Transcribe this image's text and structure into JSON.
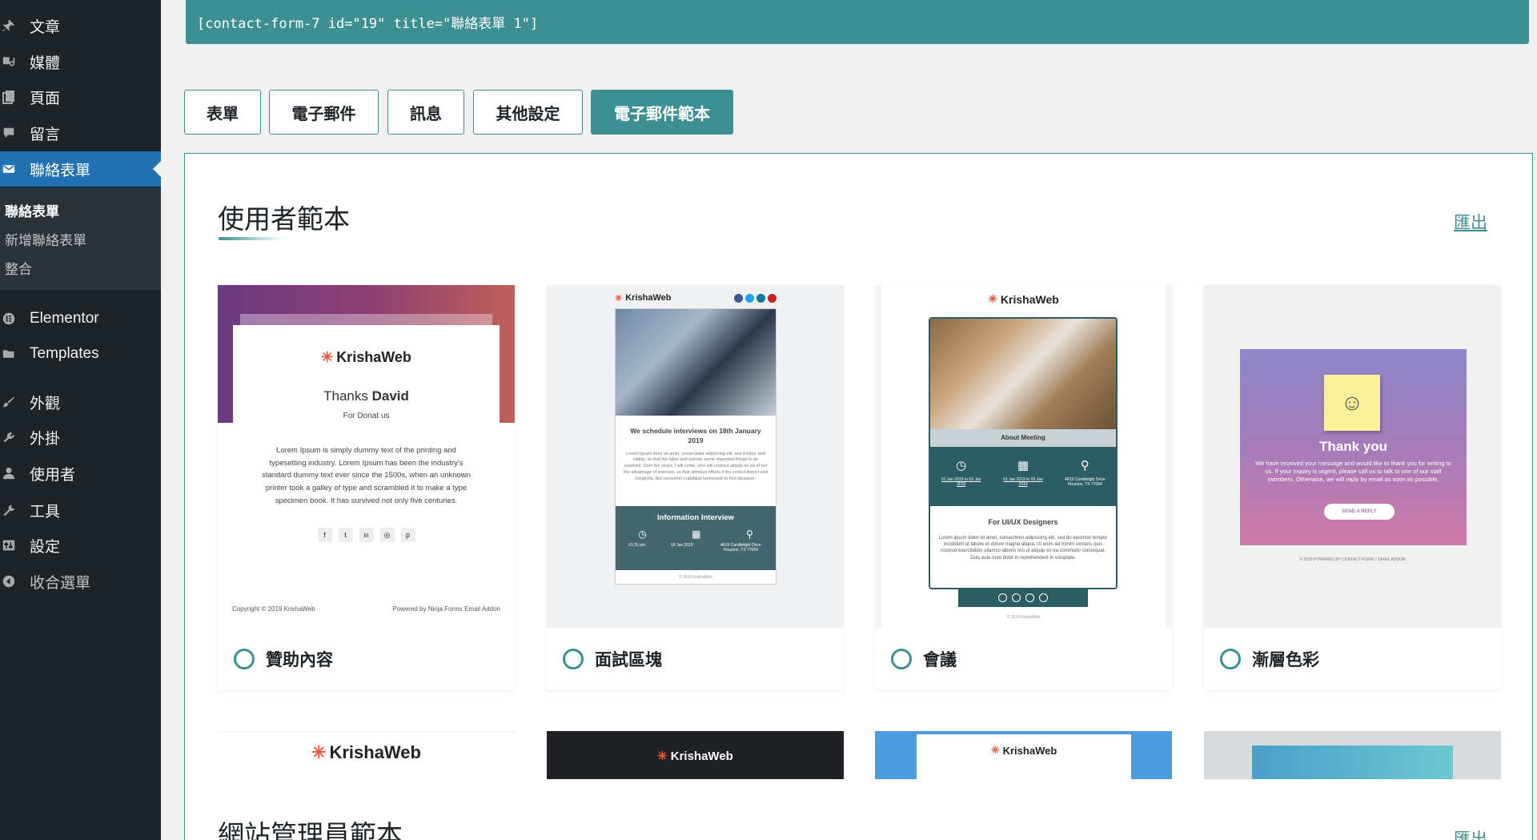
{
  "sidebar": {
    "items": [
      {
        "label": "文章",
        "icon": "pin-icon"
      },
      {
        "label": "媒體",
        "icon": "media-icon"
      },
      {
        "label": "頁面",
        "icon": "page-icon"
      },
      {
        "label": "留言",
        "icon": "comment-icon"
      },
      {
        "label": "聯絡表單",
        "icon": "mail-icon"
      },
      {
        "label": "Elementor",
        "icon": "elementor-icon"
      },
      {
        "label": "Templates",
        "icon": "folder-icon"
      },
      {
        "label": "外觀",
        "icon": "brush-icon"
      },
      {
        "label": "外掛",
        "icon": "plugin-icon"
      },
      {
        "label": "使用者",
        "icon": "user-icon"
      },
      {
        "label": "工具",
        "icon": "wrench-icon"
      },
      {
        "label": "設定",
        "icon": "settings-icon"
      },
      {
        "label": "收合選單",
        "icon": "collapse-icon"
      }
    ],
    "submenu": [
      "聯絡表單",
      "新增聯絡表單",
      "整合"
    ]
  },
  "shortcode": "[contact-form-7 id=\"19\" title=\"聯絡表單 1\"]",
  "tabs": [
    "表單",
    "電子郵件",
    "訊息",
    "其他設定",
    "電子郵件範本"
  ],
  "active_tab": "電子郵件範本",
  "sections": {
    "user_templates": {
      "title": "使用者範本",
      "export": "匯出"
    },
    "admin_templates": {
      "title": "網站管理員範本",
      "export": "匯出"
    }
  },
  "cards": [
    {
      "label": "贊助內容",
      "logo": "KrishaWeb",
      "heading_light": "Thanks ",
      "heading_bold": "David",
      "sub": "For Donat us",
      "body": "Lorem Ipsum is simply dummy text of the printing and typesetting industry. Lorem Ipsum has been the industry's standard dummy text ever since the 1500s, when an unknown printer took a galley of type and scrambled it to make a type specimen book. It has survived not only five centuries.",
      "footer_left": "Copyright © 2019 KrishaWeb",
      "footer_right": "Powered by Ninja Forms Email Addon"
    },
    {
      "label": "面試區塊",
      "logo": "KrishaWeb",
      "heading": "We schedule interviews on 18th January 2019",
      "body": "Lorem ipsum dolor sit amet, consectetur adipiscing elit, sed tempor and vitality, so that the labor and sorrow, some important things to do eiusmod. Over the years, I will come, who will nostrud aliquip ex ea of her the advantage of exercise, so that stimulus efforts if the school district and longevity. But consumer cupidatat homework to find pleasure.",
      "band_title": "Information Interview",
      "band_time": "01:30 pm",
      "band_date": "18 Jan 2019",
      "band_addr": "4619 Candlelight Drive Houston, TX 77054",
      "copyright": "© 2019 KrishaWeb"
    },
    {
      "label": "會議",
      "logo": "KrishaWeb",
      "photo_caption": "About Meeting",
      "time": "01 Jan 2019 to 03 Jan 2019",
      "date": "01 Jan 2019 to 03 Jan 2019",
      "addr": "4619 Candlelight Drive Houston, TX 77054",
      "heading": "For UI/UX Designers",
      "body": "Lorem ipsum dolor sit amet, consectetur adipiscing elit, sed do eiusmod tempor incididunt ut labore et dolore magna aliqua. Ut enim ad minim veniam, quis nostrud exercitation ullamco laboris nisi ut aliquip ex ea commodo consequat. Duis aute irure dolor in reprehenderit in voluptate.",
      "copyright": "© 2019 KrishaWeb"
    },
    {
      "label": "漸層色彩",
      "heading": "Thank you",
      "body": "We have received your message and would like to thank you for writing to us. If your inquiry is urgent, please call us to talk to one of our staff members. Otherwise, we will reply by email as soon as possible.",
      "button": "SEND A REPLY",
      "footer": "© 2019 POWERED BY CONTACT FORM 7 EMAIL ADDON"
    }
  ],
  "row2_logos": [
    "KrishaWeb",
    "KrishaWeb",
    "KrishaWeb"
  ],
  "colors": {
    "accent": "#3d8f91",
    "sidebar": "#1e2327",
    "active": "#2271b1"
  }
}
